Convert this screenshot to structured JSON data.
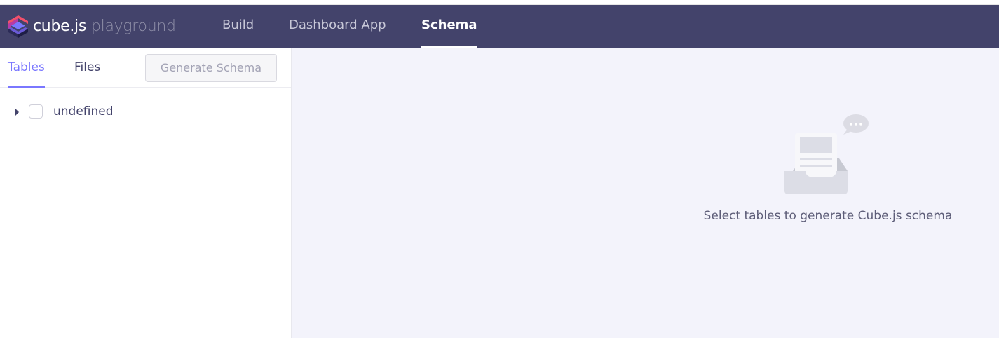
{
  "app": {
    "logo_name": "cube.js",
    "logo_suffix": "playground",
    "brand_colors": [
      "#f2506b",
      "#7a77ff",
      "#43436b"
    ]
  },
  "nav": {
    "items": [
      {
        "label": "Build",
        "active": false
      },
      {
        "label": "Dashboard App",
        "active": false
      },
      {
        "label": "Schema",
        "active": true
      }
    ]
  },
  "sidebar": {
    "tabs": [
      {
        "label": "Tables",
        "active": true
      },
      {
        "label": "Files",
        "active": false
      }
    ],
    "generate_button_label": "Generate Schema",
    "generate_button_disabled": true,
    "tree": [
      {
        "label": "undefined",
        "checked": false,
        "expanded": false
      }
    ]
  },
  "main": {
    "empty_icon": "inbox-document-chat-icon",
    "empty_message": "Select tables to generate Cube.js schema"
  }
}
